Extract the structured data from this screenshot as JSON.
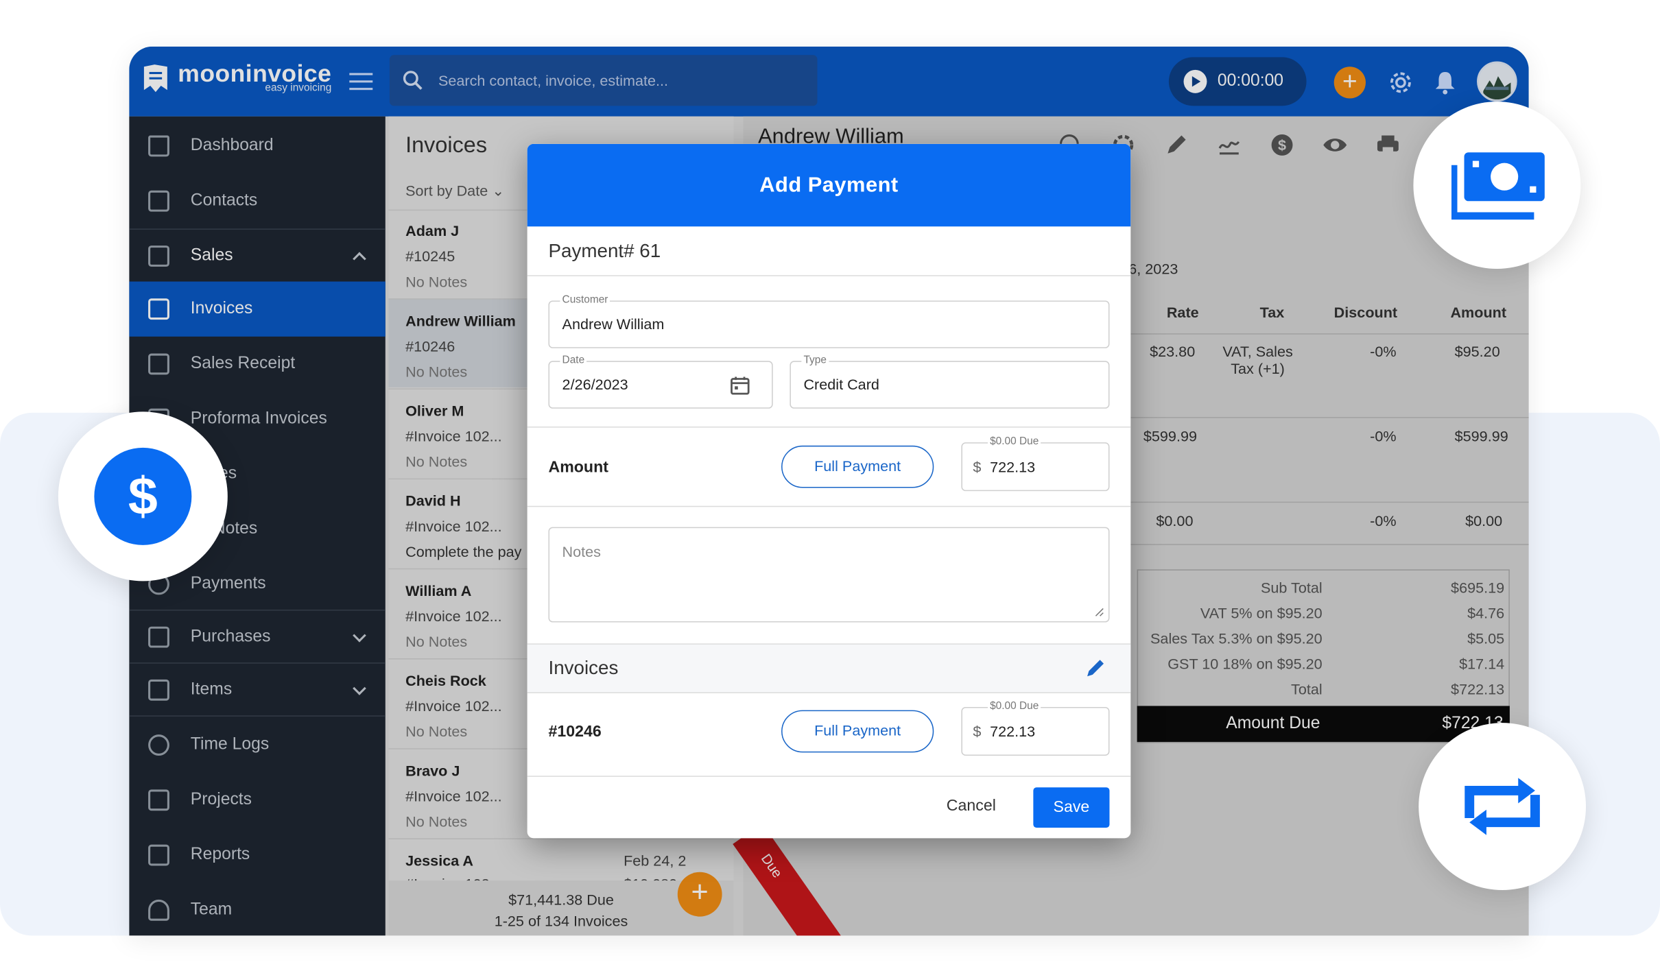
{
  "app": {
    "logo_name": "mooninvoice",
    "logo_tagline": "easy invoicing"
  },
  "topbar": {
    "search_placeholder": "Search contact, invoice, estimate...",
    "timer": "00:00:00"
  },
  "sidebar": {
    "items": [
      {
        "label": "Dashboard"
      },
      {
        "label": "Contacts"
      },
      {
        "label": "Sales"
      },
      {
        "label": "Invoices"
      },
      {
        "label": "Sales Receipt"
      },
      {
        "label": "Proforma Invoices"
      },
      {
        "label": "mates"
      },
      {
        "label": "dit Notes"
      },
      {
        "label": "Payments"
      },
      {
        "label": "Purchases"
      },
      {
        "label": "Items"
      },
      {
        "label": "Time Logs"
      },
      {
        "label": "Projects"
      },
      {
        "label": "Reports"
      },
      {
        "label": "Team"
      }
    ]
  },
  "invoice_list": {
    "title": "Invoices",
    "sort_label": "Sort by Date",
    "rows": [
      {
        "name": "Adam J",
        "number": "#10245",
        "note": "No Notes",
        "date": ""
      },
      {
        "name": "Andrew William",
        "number": "#10246",
        "note": "No Notes",
        "date": ""
      },
      {
        "name": "Oliver M",
        "number": "#Invoice 102...",
        "note": "No Notes",
        "date": ""
      },
      {
        "name": "David H",
        "number": "#Invoice 102...",
        "note": "Complete the pay",
        "date": ""
      },
      {
        "name": "William A",
        "number": "#Invoice 102...",
        "note": "No Notes",
        "date": ""
      },
      {
        "name": "Cheis Rock",
        "number": "#Invoice 102...",
        "note": "No Notes",
        "date": ""
      },
      {
        "name": "Bravo J",
        "number": "#Invoice 102...",
        "note": "No Notes",
        "date": ""
      },
      {
        "name": "Jessica A",
        "number": "#Invoice 102...",
        "note": "",
        "date": "Feb 24, 2",
        "amount": "$10,080.00"
      }
    ],
    "footer_due": "$71,441.38  Due",
    "footer_count": "1-25 of 134 Invoices"
  },
  "detail": {
    "customer": "Andrew William",
    "date_fragment": "6, 2023",
    "headers": {
      "rate": "Rate",
      "tax": "Tax",
      "discount": "Discount",
      "amount": "Amount"
    },
    "lines": [
      {
        "rate": "$23.80",
        "tax1": "VAT, Sales",
        "tax2": "Tax (+1)",
        "discount": "-0%",
        "amount": "$95.20"
      },
      {
        "rate": "$599.99",
        "tax1": "",
        "tax2": "",
        "discount": "-0%",
        "amount": "$599.99"
      },
      {
        "rate": "$0.00",
        "tax1": "",
        "tax2": "",
        "discount": "-0%",
        "amount": "$0.00"
      }
    ],
    "totals": [
      {
        "label": "Sub Total",
        "value": "$695.19"
      },
      {
        "label": "VAT 5% on $95.20",
        "value": "$4.76"
      },
      {
        "label": "Sales Tax 5.3% on $95.20",
        "value": "$5.05"
      },
      {
        "label": "GST 10 18% on $95.20",
        "value": "$17.14"
      },
      {
        "label": "Total",
        "value": "$722.13"
      }
    ],
    "amount_due_label": "Amount Due",
    "amount_due_value": "$722.13",
    "ribbon": "Due"
  },
  "modal": {
    "title": "Add Payment",
    "payment_no": "Payment# 61",
    "customer_label": "Customer",
    "customer_value": "Andrew William",
    "date_label": "Date",
    "date_value": "2/26/2023",
    "type_label": "Type",
    "type_value": "Credit Card",
    "amount_label": "Amount",
    "full_payment": "Full Payment",
    "due_label": "$0.00 Due",
    "currency": "$",
    "amount_value": "722.13",
    "notes_placeholder": "Notes",
    "invoices_title": "Invoices",
    "invoice_number": "#10246",
    "invoice_full_payment": "Full Payment",
    "invoice_due_label": "$0.00 Due",
    "invoice_amount": "722.13",
    "cancel": "Cancel",
    "save": "Save"
  },
  "colors": {
    "brand_blue": "#0a58c3",
    "modal_blue": "#0a6cf2",
    "sidebar": "#1e2631",
    "accent_orange": "#f08c14",
    "due_red": "#c8171b"
  }
}
